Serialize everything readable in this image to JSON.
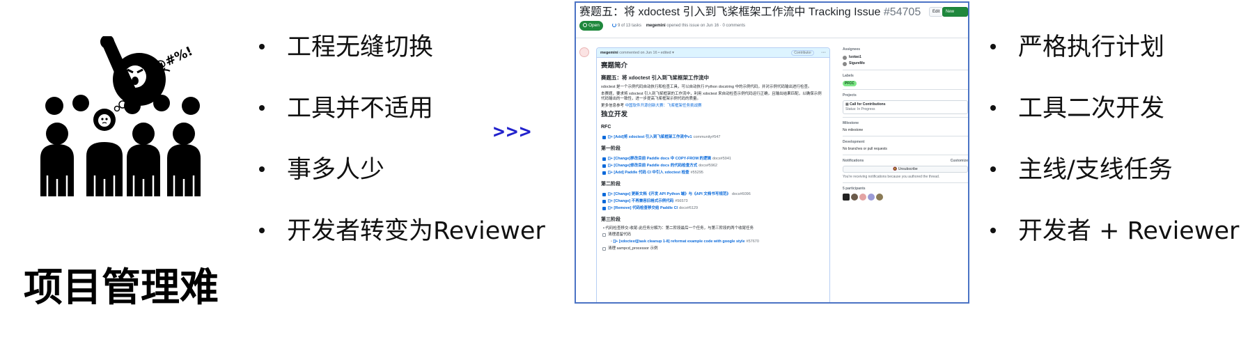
{
  "slide": {
    "headline": "项目管理难",
    "arrows": ">>>",
    "left_points": [
      "工程无缝切换",
      "工具并不适用",
      "事多人少",
      "开发者转变为Reviewer"
    ],
    "right_points": [
      "严格执行计划",
      "工具二次开发",
      "主线/支线任务",
      "开发者 + Reviewer"
    ],
    "illustration": {
      "icon": "frustrated-crowd-icon",
      "speech_text": "@#%!"
    }
  },
  "issue": {
    "title": "赛题五：将 xdoctest 引入到飞桨框架工作流中 Tracking Issue",
    "number": "#54705",
    "edit_label": "Edit",
    "new_issue_label": "New issue",
    "state": "Open",
    "tasks": "9 of 13 tasks",
    "opened_by": "megemini",
    "opened_text": "opened this issue on Jun 16 · 0 comments",
    "comment": {
      "author": "megemini",
      "header_text": "commented on Jun 16 • edited",
      "role": "Contributor",
      "more": "···",
      "intro_heading": "赛题简介",
      "intro_title": "赛题五：将 xdoctest 引入到飞桨框架工作流中",
      "para1": "xdoctest 是一个示例代码自动执行和检查工具，可以自动执行 Python docstring 中的示例代码，并对示例代码输出进行检查。",
      "para2": "本赛题，要求将 xdoctest 引入到飞桨框架的工作流中，利用 xdoctest 来自动检查示例代码运行正确，且输出结果匹配，以确保示例代码输出的一致性，进一步提高飞桨框架示例代码的质量。",
      "more_info": "更多信息参考",
      "more_info_link": "中国软件开源创新大赛：飞桨框架任务挑战赛",
      "dev_heading": "独立开发",
      "rfc_heading": "RFC",
      "rfc_tasks": [
        {
          "text": "[]+ [Add]将 xdoctest 引入到飞桨框架工作流中v1",
          "ref": "community#547"
        }
      ],
      "stage1_heading": "第一阶段",
      "stage1_tasks": [
        {
          "text": "[]+ [Change]移改目前 Paddle docs 中 COPY-FROM 的逻辑",
          "ref": "docs#5941"
        },
        {
          "text": "[]+ [Change]修改目前 Paddle docs 的代码检查方式",
          "ref": "docs#5962"
        },
        {
          "text": "[]+ [Add] Paddle 代码 CI 中引入 xdoctest 检查",
          "ref": "#55295"
        }
      ],
      "stage2_heading": "第二阶段",
      "stage2_tasks": [
        {
          "text": "[]+ [Change] 更新文档《开发 API Python 端》与《API 文档书写规范》",
          "ref": "docs#6096"
        },
        {
          "text": "[]+ [Change] 不再兼容旧格式示例代码",
          "ref": "#56573"
        },
        {
          "text": "[]+ [Remove] 代码检查移交给 Paddle CI",
          "ref": "docs#6129"
        }
      ],
      "stage3_heading": "第三阶段",
      "stage3_bullet": "代码检查移交-收尾-此任务分解为：第二阶段最后一个任务，与第三阶段的两个收尾任务",
      "stage3_task1": "清理遗留代码",
      "stage3_subtask": "[]+ [xdoctest][task cleanup 1-8] reformat example code with google style",
      "stage3_subtask_ref": "#57670",
      "stage3_task2": "清理 sampcd_processor 示例"
    },
    "sidebar": {
      "assignees_label": "Assignees",
      "assignees": [
        "luotao1",
        "SigureMo"
      ],
      "labels_label": "Labels",
      "label_tag": "PFCC",
      "projects_label": "Projects",
      "project_name": "Call for Contributions",
      "project_status": "Status: In Progress",
      "milestone_label": "Milestone",
      "milestone_value": "No milestone",
      "development_label": "Development",
      "development_value": "No branches or pull requests",
      "notifications_label": "Notifications",
      "customize_label": "Customize",
      "unsubscribe_label": "Unsubscribe",
      "notifications_note": "You're receiving notifications because you authored the thread.",
      "participants_label": "5 participants"
    }
  }
}
